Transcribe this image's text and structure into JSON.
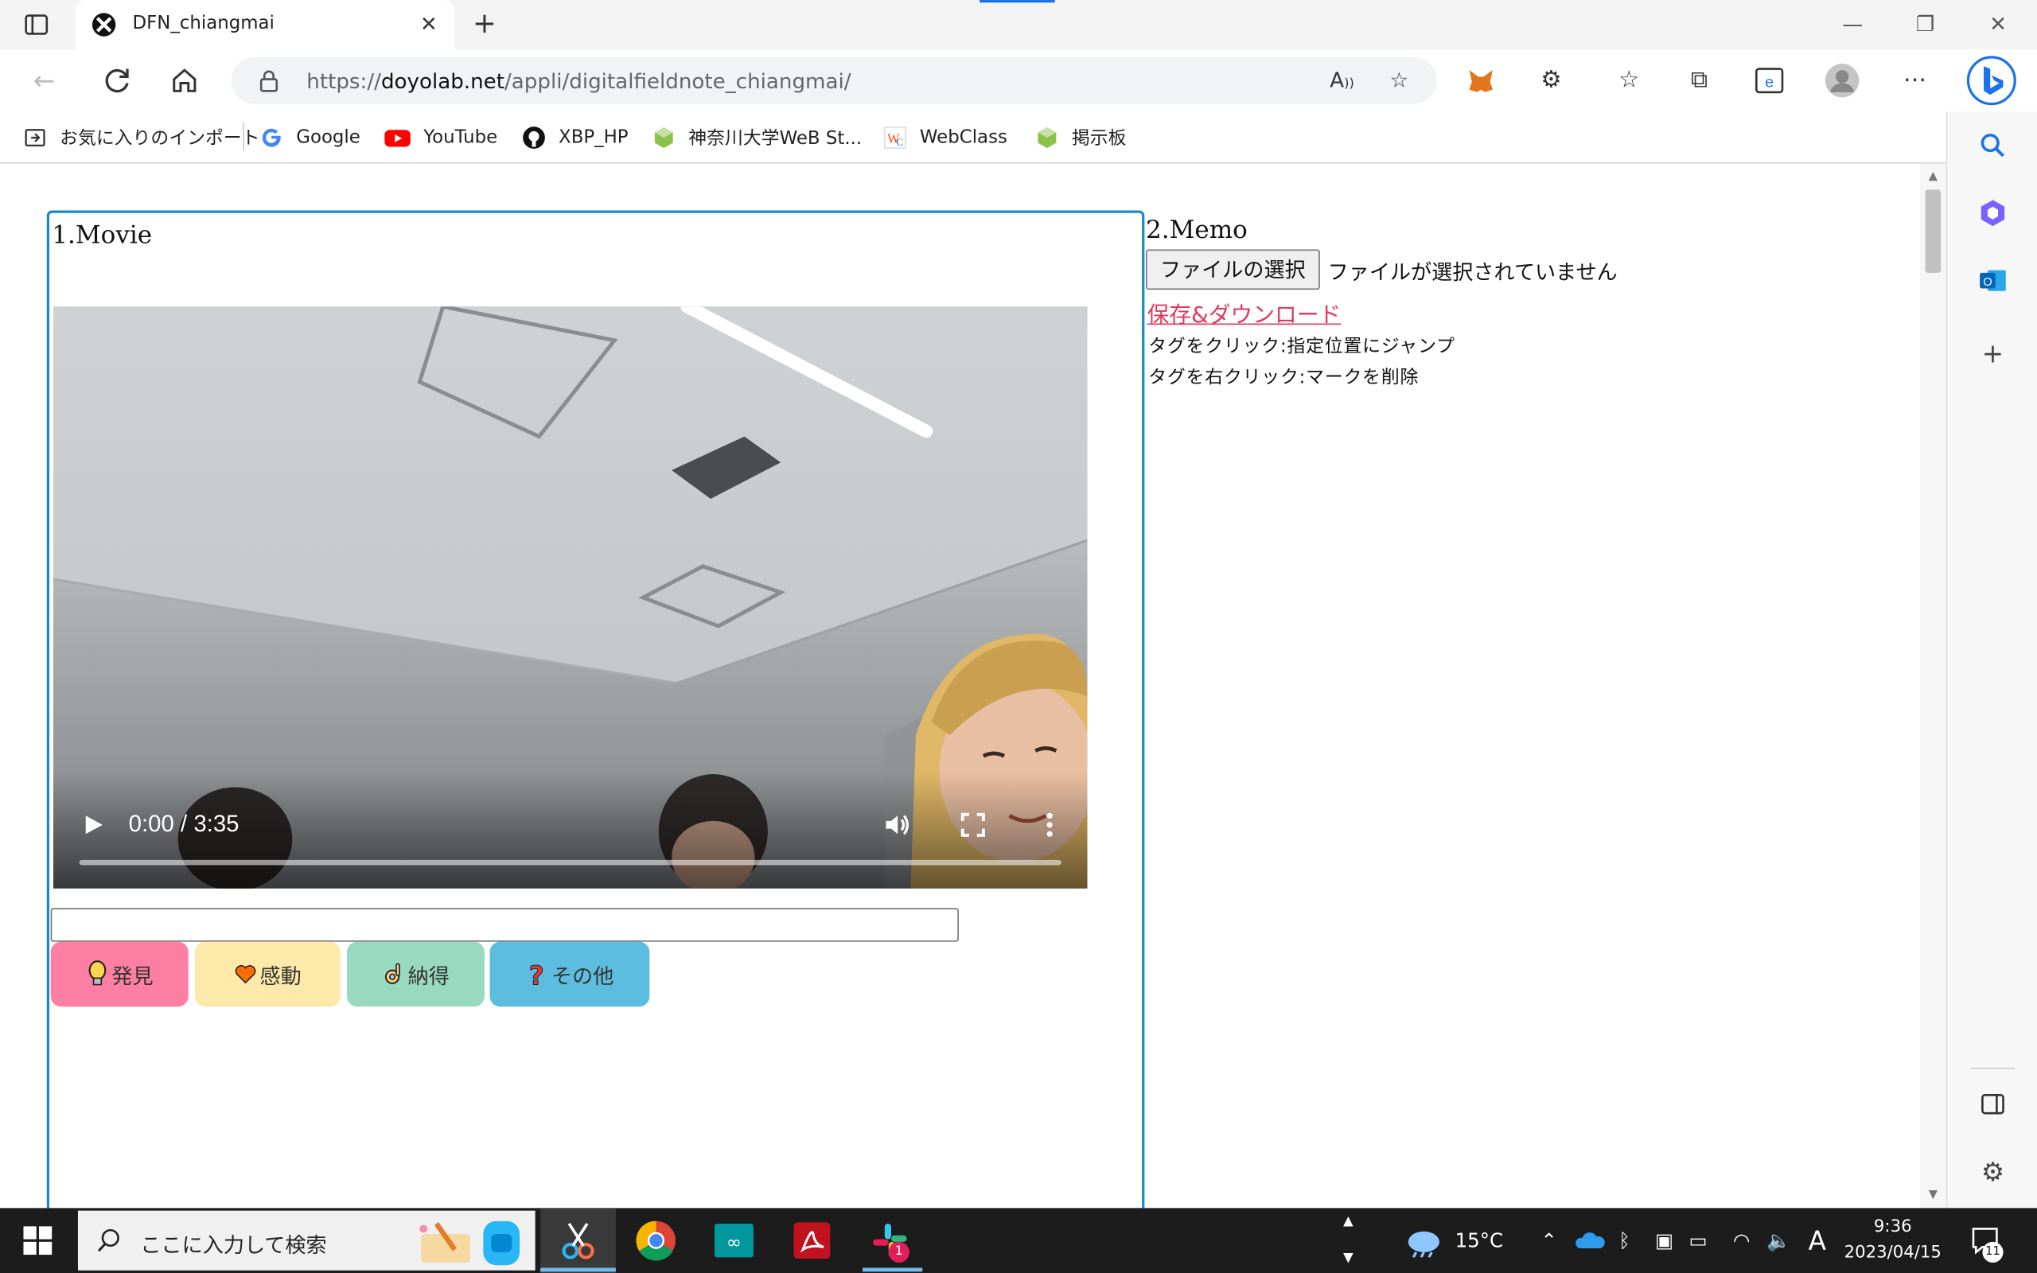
{
  "browser": {
    "tab_title": "DFN_chiangmai",
    "url_prefix": "https://",
    "url_domain": "doyolab.net",
    "url_path": "/appli/digitalfieldnote_chiangmai/"
  },
  "bookmarks": [
    {
      "label": "お気に入りのインポート",
      "icon": "import-favorites-icon"
    },
    {
      "label": "Google",
      "icon": "google-icon"
    },
    {
      "label": "YouTube",
      "icon": "youtube-icon"
    },
    {
      "label": "XBP_HP",
      "icon": "github-icon"
    },
    {
      "label": "神奈川大学WeB St...",
      "icon": "green-cube-icon"
    },
    {
      "label": "WebClass",
      "icon": "webclass-icon"
    },
    {
      "label": "掲示板",
      "icon": "green-cube-icon"
    }
  ],
  "movie": {
    "title": "1.Movie",
    "time": "0:00 / 3:35",
    "tags": [
      {
        "label": "発見",
        "color": "#fd7fa3",
        "icon": "lightbulb-icon"
      },
      {
        "label": "感動",
        "color": "#fde9a9",
        "icon": "heart-icon"
      },
      {
        "label": "納得",
        "color": "#98d9c0",
        "icon": "ok-hand-icon"
      },
      {
        "label": "その他",
        "color": "#5cbde0",
        "icon": "question-icon"
      }
    ]
  },
  "memo": {
    "title": "2.Memo",
    "file_button": "ファイルの選択",
    "file_status": "ファイルが選択されていません",
    "save_link": "保存&ダウンロード",
    "hint_1": "タグをクリック:指定位置にジャンプ",
    "hint_2": "タグを右クリック:マークを削除"
  },
  "taskbar": {
    "search_placeholder": "ここに入力して検索",
    "weather": "15°C",
    "ime": "A",
    "time": "9:36",
    "date": "2023/04/15",
    "notification_count": "11",
    "slack_badge": "1"
  }
}
